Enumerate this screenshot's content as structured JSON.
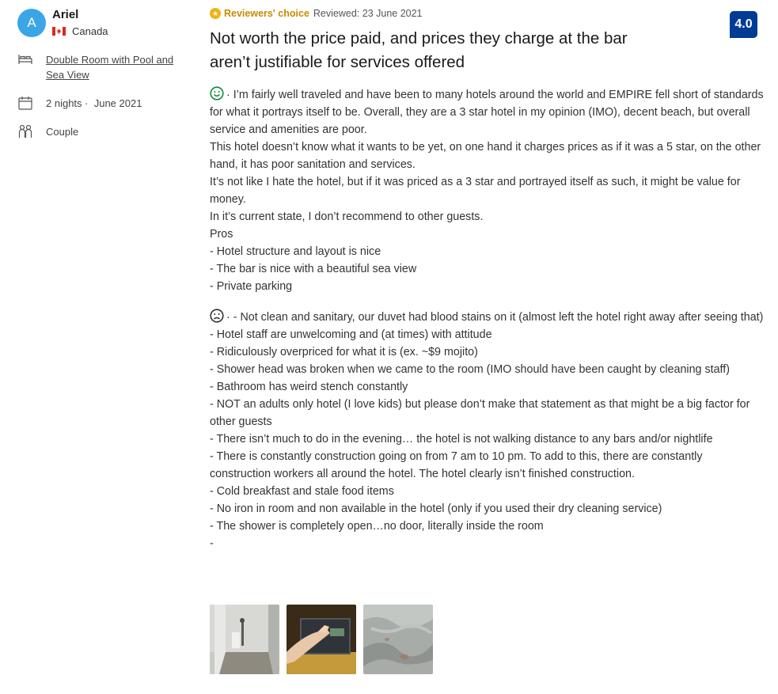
{
  "reviewer": {
    "initial": "A",
    "name": "Ariel",
    "country": "Canada"
  },
  "stay": {
    "room": "Double Room with Pool and Sea View",
    "nights": "2 nights ·",
    "month": "June 2021",
    "traveler_type": "Couple"
  },
  "review": {
    "badge_label": "Reviewers' choice",
    "reviewed_date": "Reviewed: 23 June 2021",
    "score": "4.0",
    "title": "Not worth the price paid, and prices they charge at the bar aren’t justifiable for services offered",
    "liked": [
      "· I’m fairly well traveled and have been to many hotels around the world and EMPIRE fell short of standards for what it portrays itself to be. Overall, they are a 3 star hotel in my opinion (IMO), decent beach, but overall service and amenities are poor.",
      "This hotel doesn’t know what it wants to be yet, on one hand it charges prices as if it was a 5 star, on the other hand, it has poor sanitation and services.",
      "It’s not like I hate the hotel, but if it was priced as a 3 star and portrayed itself as such, it might be value for money.",
      "In it’s current state, I don’t recommend to other guests.",
      "Pros",
      "- Hotel structure and layout is nice",
      "- The bar is nice with a beautiful sea view",
      "- Private parking"
    ],
    "disliked": [
      "· - Not clean and sanitary, our duvet had blood stains on it (almost left the hotel right away after seeing that)",
      "- Hotel staff are unwelcoming and (at times) with attitude",
      "- Ridiculously overpriced for what it is (ex. ~$9 mojito)",
      "- Shower head was broken when we came to the room (IMO should have been caught by cleaning staff)",
      "- Bathroom has weird stench constantly",
      "- NOT an adults only hotel (I love kids) but please don’t make that statement as that might be a big factor for other guests",
      "- There isn’t much to do in the evening… the hotel is not walking distance to any bars and/or nightlife",
      "- There is constantly construction going on from 7 am to 10 pm. To add to this, there are constantly construction workers all around the hotel. The hotel clearly isn’t finished construction.",
      "- Cold breakfast and stale food items",
      "- No iron in room and non available in the hotel (only if you used their dry cleaning service)",
      "- The shower is completely open…no door, literally inside the room",
      "-"
    ]
  },
  "photos": [
    "shower-photo",
    "safe-photo",
    "duvet-photo"
  ],
  "colors": {
    "score_bg": "#003b95",
    "avatar_bg": "#3aa6e6",
    "badge": "#f2b215"
  }
}
